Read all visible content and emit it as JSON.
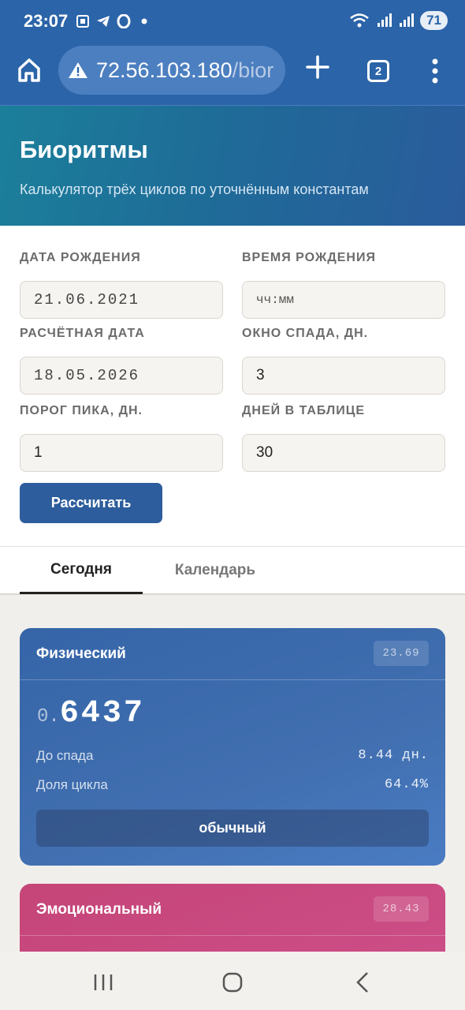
{
  "status_bar": {
    "time": "23:07",
    "battery": "71",
    "icons": [
      "screenshot-icon",
      "telegram-icon",
      "opera-icon",
      "dot-icon",
      "wifi-icon",
      "signal-icon",
      "signal-icon"
    ]
  },
  "browser": {
    "url_host": "72.56.103.180",
    "url_path": "/bior",
    "tab_count": "2"
  },
  "header": {
    "title": "Биоритмы",
    "subtitle": "Калькулятор трёх циклов по уточнённым константам"
  },
  "form": {
    "birth_date": {
      "label": "ДАТА РОЖДЕНИЯ",
      "value": "21.06.2021"
    },
    "birth_time": {
      "label": "ВРЕМЯ РОЖДЕНИЯ",
      "placeholder": "чч:мм"
    },
    "calc_date": {
      "label": "РАСЧЁТНАЯ ДАТА",
      "value": "18.05.2026"
    },
    "decline_window": {
      "label": "ОКНО СПАДА, ДН.",
      "value": "3"
    },
    "peak_threshold": {
      "label": "ПОРОГ ПИКА, ДН.",
      "value": "1"
    },
    "table_days": {
      "label": "ДНЕЙ В ТАБЛИЦЕ",
      "value": "30"
    },
    "calc_button": "Рассчитать"
  },
  "tabs": [
    {
      "label": "Сегодня",
      "active": true
    },
    {
      "label": "Календарь",
      "active": false
    }
  ],
  "cards": {
    "physical": {
      "title": "Физический",
      "period": "23.69",
      "value_prefix": "0.",
      "value_main": "6437",
      "rows": [
        {
          "label": "До спада",
          "value": "8.44 дн."
        },
        {
          "label": "Доля цикла",
          "value": "64.4%"
        }
      ],
      "state": "обычный",
      "color": "#3a69ad"
    },
    "emotional": {
      "title": "Эмоциональный",
      "period": "28.43",
      "color": "#c84a80"
    }
  },
  "colors": {
    "accent": "#2b64a8",
    "button": "#2d5d9c"
  }
}
